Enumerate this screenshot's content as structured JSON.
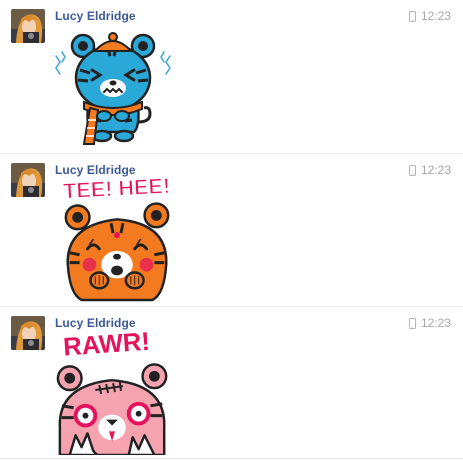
{
  "messages": [
    {
      "sender": "Lucy Eldridge",
      "time": "12:23",
      "sticker": "blue-tiger-cold-shivering-icon"
    },
    {
      "sender": "Lucy Eldridge",
      "time": "12:23",
      "sticker": "orange-tiger-tee-hee-icon",
      "sticker_text": "TEE! HEE!"
    },
    {
      "sender": "Lucy Eldridge",
      "time": "12:23",
      "sticker": "pink-zombie-tiger-rawr-icon",
      "sticker_text": "RAWR!"
    }
  ],
  "colors": {
    "sender_name": "#3b5998",
    "timestamp": "#a8a8a8",
    "sticker_text": "#e3145b",
    "blue_tiger": "#2aa8d8",
    "orange_tiger": "#f47a20",
    "pink_tiger": "#f6a3b0"
  }
}
